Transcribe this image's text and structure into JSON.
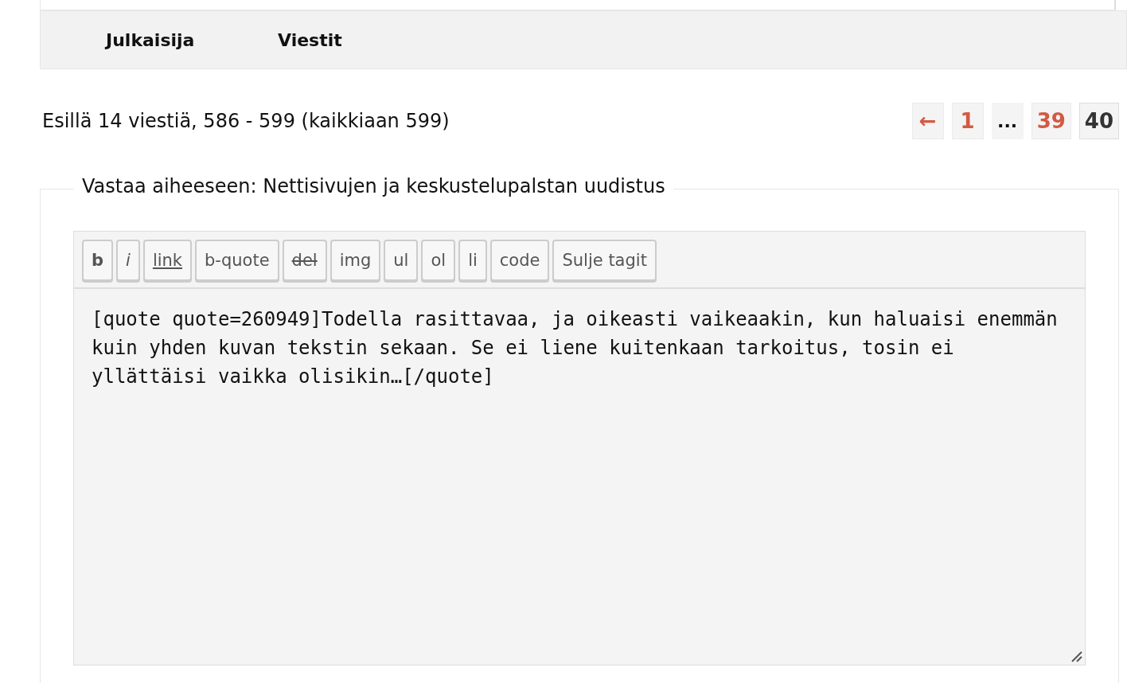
{
  "table_header": {
    "columns": [
      "Julkaisija",
      "Viestit"
    ]
  },
  "summary": "Esillä 14 viestiä, 586 - 599 (kaikkiaan 599)",
  "pagination": [
    {
      "label": "←",
      "kind": "link",
      "selected": false
    },
    {
      "label": "1",
      "kind": "link",
      "selected": false
    },
    {
      "label": "...",
      "kind": "dots"
    },
    {
      "label": "39",
      "kind": "link",
      "selected": false
    },
    {
      "label": "40",
      "kind": "link",
      "selected": true
    }
  ],
  "reply_form": {
    "legend": "Vastaa aiheeseen: Nettisivujen ja keskustelupalstan uudistus",
    "toolbar": [
      {
        "label": "b",
        "kind": "bold"
      },
      {
        "label": "i",
        "kind": "italic"
      },
      {
        "label": "link",
        "kind": "underline"
      },
      {
        "label": "b-quote",
        "kind": "plain"
      },
      {
        "label": "del",
        "kind": "strike"
      },
      {
        "label": "img",
        "kind": "plain"
      },
      {
        "label": "ul",
        "kind": "plain"
      },
      {
        "label": "ol",
        "kind": "plain"
      },
      {
        "label": "li",
        "kind": "plain"
      },
      {
        "label": "code",
        "kind": "plain"
      },
      {
        "label": "Sulje tagit",
        "kind": "plain"
      }
    ],
    "message": "[quote quote=260949]Todella rasittavaa, ja oikeasti vaikeaakin, kun haluaisi enemmän kuin yhden kuvan tekstin sekaan. Se ei liene kuitenkaan tarkoitus, tosin ei yllättäisi vaikka olisikin…[/quote]"
  }
}
